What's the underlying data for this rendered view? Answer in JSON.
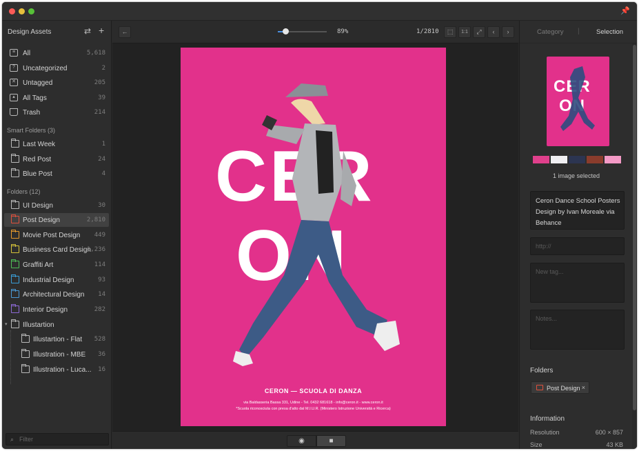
{
  "sidebar": {
    "title": "Design Assets",
    "library": [
      {
        "label": "All",
        "count": "5,618",
        "icon": "all-items-icon"
      },
      {
        "label": "Uncategorized",
        "count": "2",
        "icon": "uncategorized-icon"
      },
      {
        "label": "Untagged",
        "count": "205",
        "icon": "untagged-icon"
      },
      {
        "label": "All Tags",
        "count": "39",
        "icon": "tag-icon"
      },
      {
        "label": "Trash",
        "count": "214",
        "icon": "trash-icon"
      }
    ],
    "smart_folders_title": "Smart Folders (3)",
    "smart_folders": [
      {
        "label": "Last Week",
        "count": "1"
      },
      {
        "label": "Red Post",
        "count": "24"
      },
      {
        "label": "Blue Post",
        "count": "4"
      }
    ],
    "folders_title": "Folders (12)",
    "folders": [
      {
        "label": "UI Design",
        "count": "30",
        "color": "#bbbbbb"
      },
      {
        "label": "Post Design",
        "count": "2,810",
        "color": "#e0503c"
      },
      {
        "label": "Movie Post Design",
        "count": "449",
        "color": "#e89a2c"
      },
      {
        "label": "Business Card Design",
        "count": "1,236",
        "color": "#d8c53a"
      },
      {
        "label": "Graffiti Art",
        "count": "114",
        "color": "#4fbf57"
      },
      {
        "label": "Industrial Design",
        "count": "93",
        "color": "#3a9fd8"
      },
      {
        "label": "Architectural Design",
        "count": "14",
        "color": "#4a9ad6"
      },
      {
        "label": "Interior Design",
        "count": "282",
        "color": "#8e6ad8"
      },
      {
        "label": "Illustartion",
        "count": "",
        "color": "#bbbbbb"
      }
    ],
    "subfolders": [
      {
        "label": "Illustartion - Flat",
        "count": "528"
      },
      {
        "label": "Illustration - MBE",
        "count": "36"
      },
      {
        "label": "Illustration - Luca...",
        "count": "16"
      }
    ],
    "filter_placeholder": "Filter"
  },
  "toolbar": {
    "zoom_label": "89%",
    "zoom_level": 0.15,
    "page_label": "1/2810",
    "one_to_one": "1:1"
  },
  "poster": {
    "word_top": "CER",
    "word_bottom": "ON",
    "headline": "CERON — SCUOLA DI DANZA",
    "line1": "via Baldasseria Bassa 331, Udine - Tel. 0432 681618 - info@ceron.it - www.ceron.it",
    "line2": "*Scuola riconosciuta con presa d'atto dal M.I.U.R. (Ministero Istruzione Università e Ricerca)"
  },
  "right_panel": {
    "tab_category": "Category",
    "tab_selection": "Selection",
    "palette": [
      "#e0408c",
      "#f0eff2",
      "#2c3551",
      "#8a3c2c",
      "#f49ac6"
    ],
    "selected_text": "1 image selected",
    "annotation": "Ceron Dance School Posters Design by Ivan Moreale via Behance",
    "url_placeholder": "http://",
    "tag_placeholder": "New tag...",
    "notes_placeholder": "Notes...",
    "folders_title": "Folders",
    "folder_chip": "Post Design",
    "folder_chip_close": "×",
    "info_title": "Information",
    "resolution_label": "Resolution",
    "resolution_value": "600 × 857",
    "size_label": "Size",
    "size_value": "43 KB"
  },
  "colors": {
    "accent": "#4a90e2",
    "poster_pink": "#e2318b",
    "traffic_close": "#fc5b57",
    "traffic_min": "#e5bf3c",
    "traffic_max": "#57c038"
  }
}
